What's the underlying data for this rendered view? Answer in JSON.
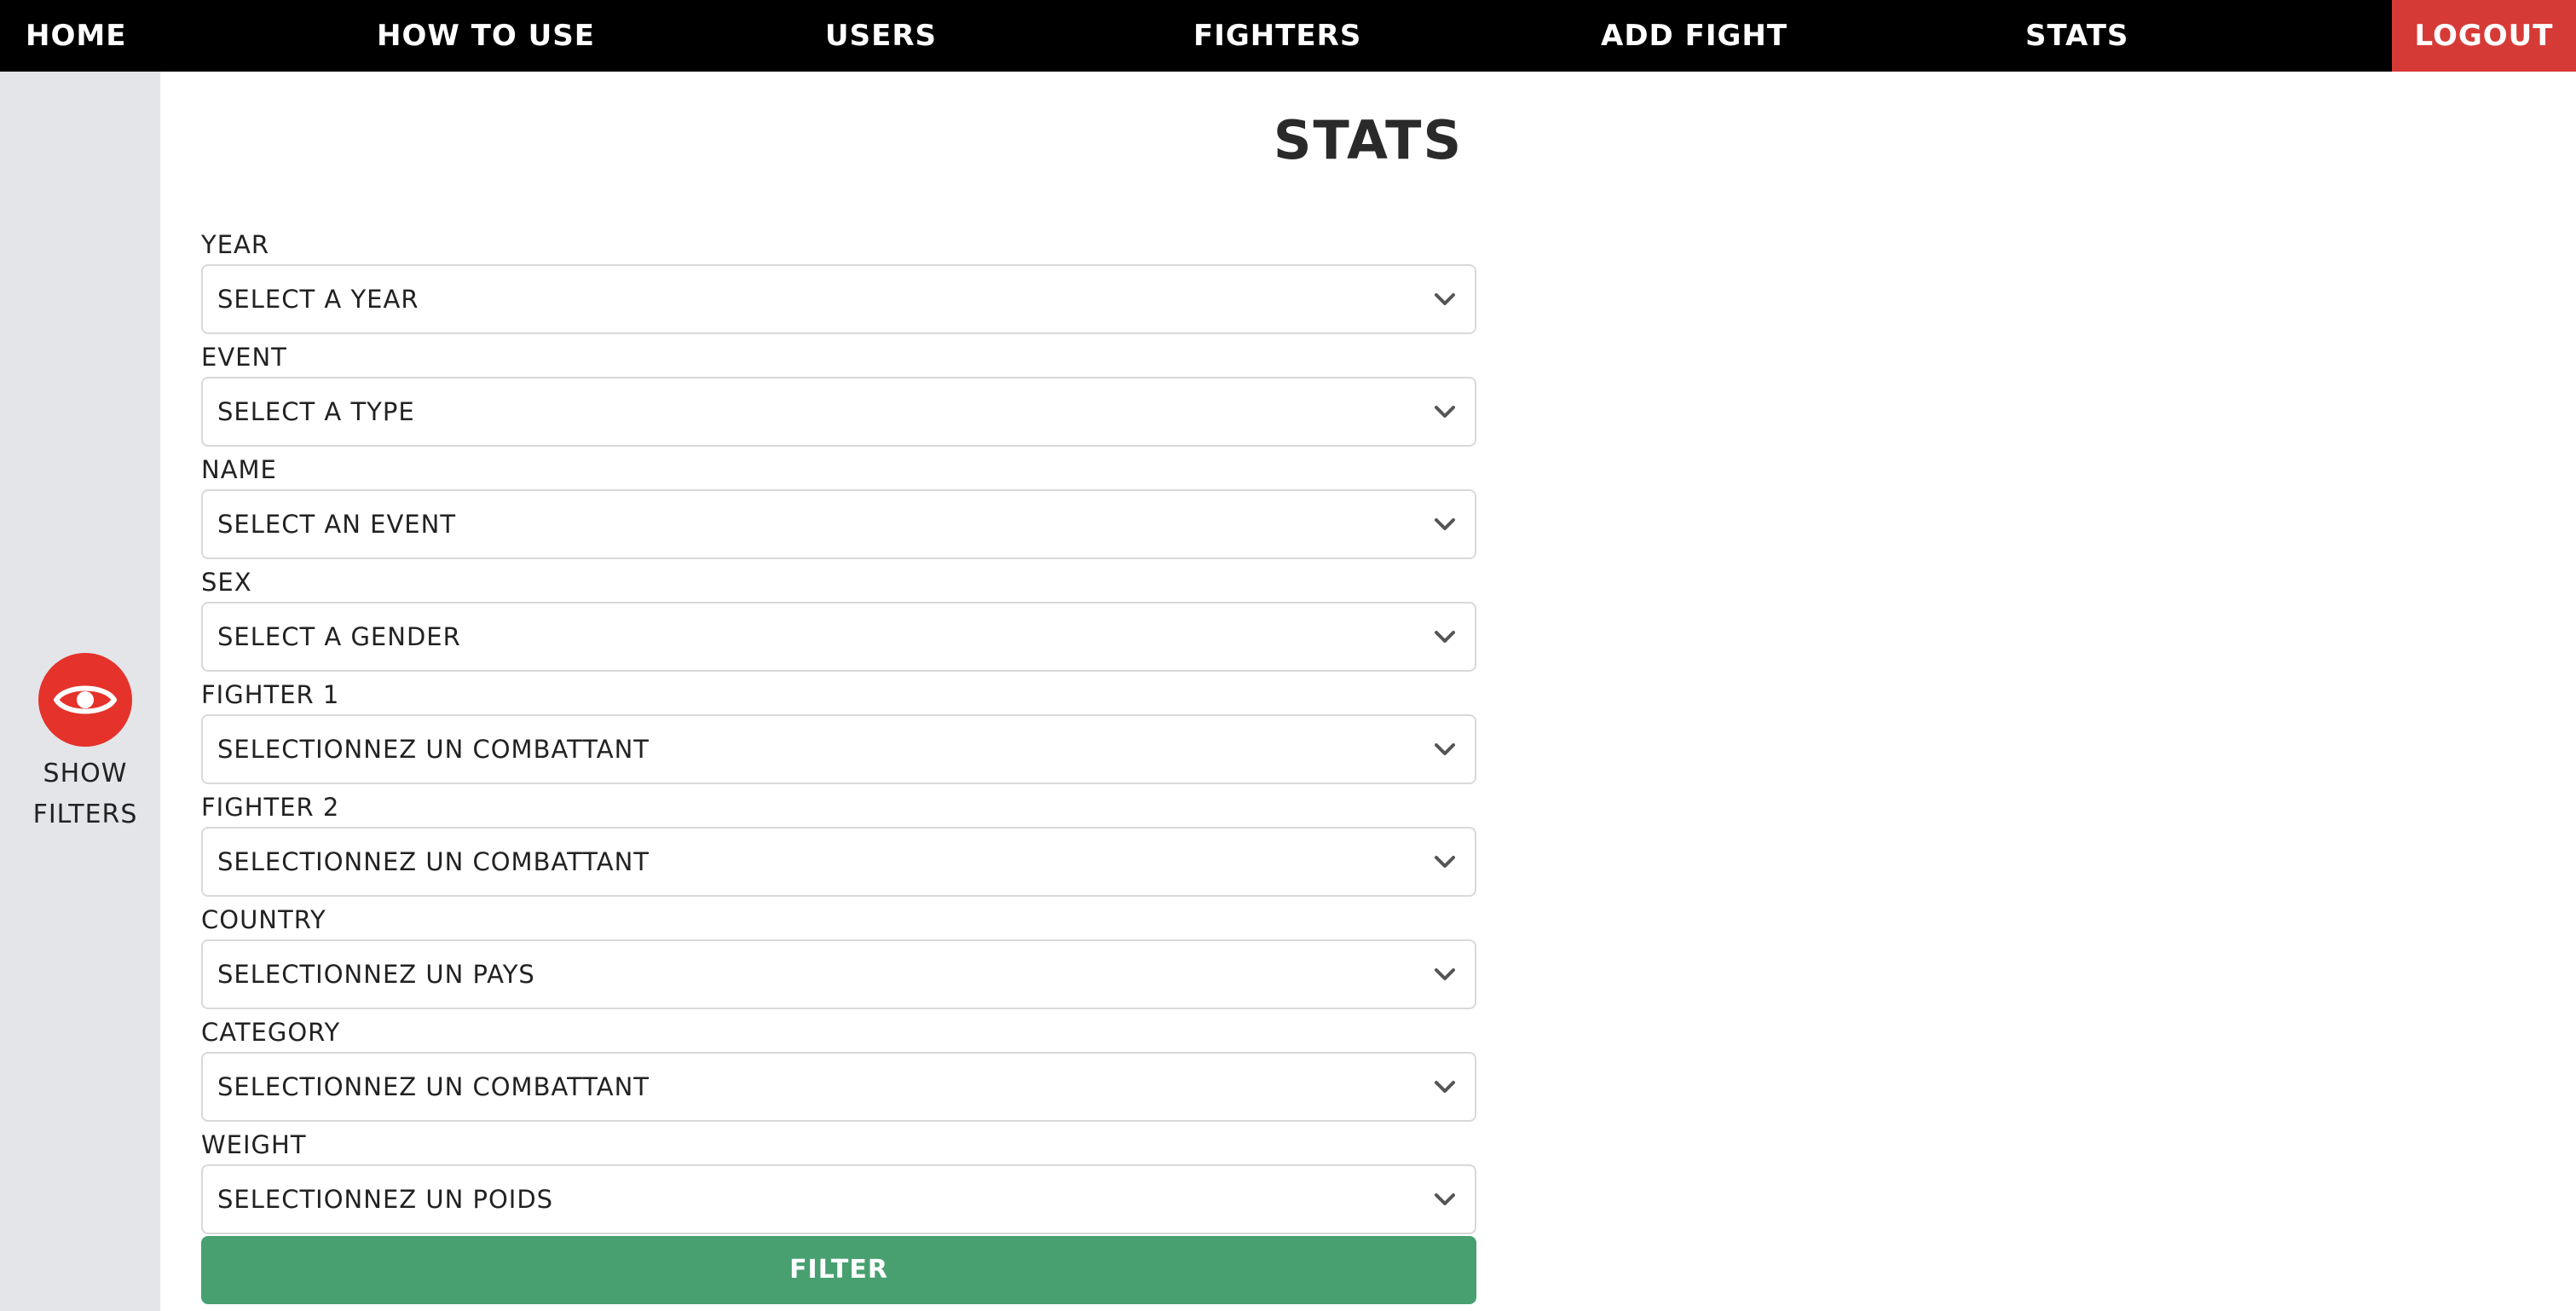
{
  "nav": {
    "home": "HOME",
    "how_to_use": "HOW TO USE",
    "users": "USERS",
    "fighters": "FIGHTERS",
    "add_fight": "ADD FIGHT",
    "stats": "STATS",
    "logout": "LOGOUT"
  },
  "sidebar": {
    "toggle_icon": "eye-icon",
    "line1": "SHOW",
    "line2": "FILTERS"
  },
  "page": {
    "title": "STATS"
  },
  "filters": [
    {
      "label": "YEAR",
      "value": "SELECT A YEAR"
    },
    {
      "label": "EVENT",
      "value": "SELECT A TYPE"
    },
    {
      "label": "NAME",
      "value": "SELECT AN EVENT"
    },
    {
      "label": "SEX",
      "value": "SELECT A GENDER"
    },
    {
      "label": "FIGHTER 1",
      "value": "SELECTIONNEZ UN COMBATTANT"
    },
    {
      "label": "FIGHTER 2",
      "value": "SELECTIONNEZ UN COMBATTANT"
    },
    {
      "label": "COUNTRY",
      "value": "SELECTIONNEZ UN PAYS"
    },
    {
      "label": "CATEGORY",
      "value": "SELECTIONNEZ UN COMBATTANT"
    },
    {
      "label": "WEIGHT",
      "value": "SELECTIONNEZ UN POIDS"
    }
  ],
  "filter_button": "FILTER",
  "colors": {
    "nav_bg": "#000000",
    "logout_bg": "#d63a37",
    "sidebar_bg": "#e4e5e8",
    "accent_red": "#e5322b",
    "filter_green": "#48a070"
  }
}
